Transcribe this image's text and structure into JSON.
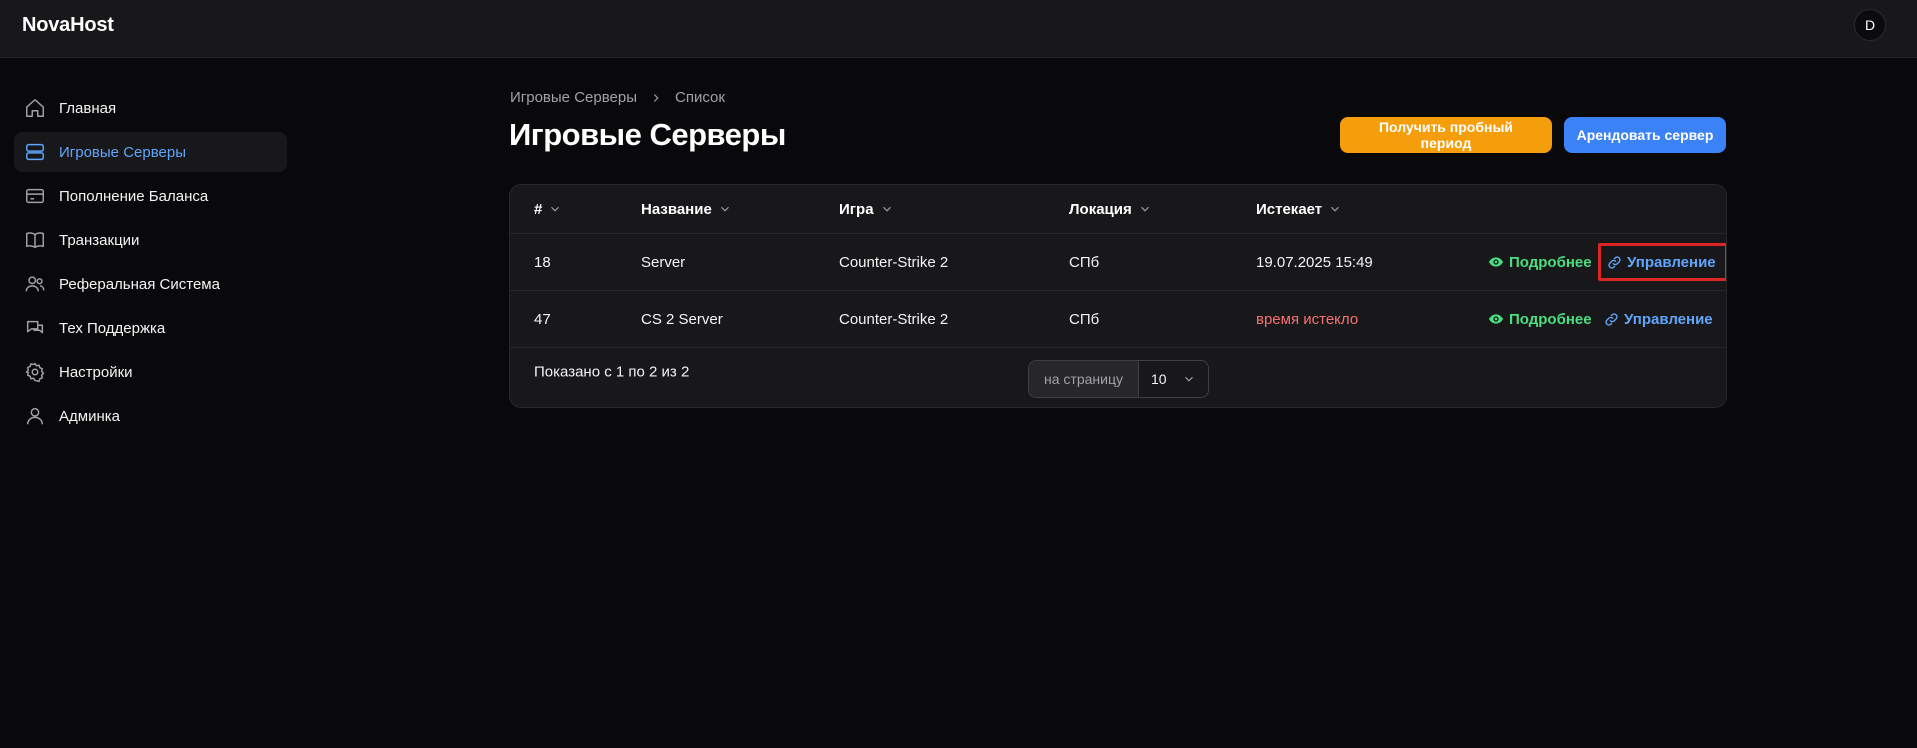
{
  "app": {
    "brand": "NovaHost",
    "avatar_letter": "D"
  },
  "sidebar": {
    "items": [
      {
        "label": "Главная",
        "icon": "home-icon",
        "active": false
      },
      {
        "label": "Игровые Серверы",
        "icon": "server-icon",
        "active": true
      },
      {
        "label": "Пополнение Баланса",
        "icon": "credit-card-icon",
        "active": false
      },
      {
        "label": "Транзакции",
        "icon": "book-icon",
        "active": false
      },
      {
        "label": "Реферальная Система",
        "icon": "users-icon",
        "active": false
      },
      {
        "label": "Тех Поддержка",
        "icon": "chat-icon",
        "active": false
      },
      {
        "label": "Настройки",
        "icon": "gear-icon",
        "active": false
      },
      {
        "label": "Админка",
        "icon": "user-icon",
        "active": false
      }
    ]
  },
  "breadcrumb": {
    "parent": "Игровые Серверы",
    "current": "Список"
  },
  "page": {
    "title": "Игровые Серверы"
  },
  "actions": {
    "trial_label": "Получить пробный период",
    "rent_label": "Арендовать сервер"
  },
  "table": {
    "columns": [
      "#",
      "Название",
      "Игра",
      "Локация",
      "Истекает"
    ],
    "rows": [
      {
        "id": "18",
        "name": "Server",
        "game": "Counter-Strike 2",
        "location": "СПб",
        "expires": "19.07.2025 15:49",
        "expired": false
      },
      {
        "id": "47",
        "name": "CS 2 Server",
        "game": "Counter-Strike 2",
        "location": "СПб",
        "expires": "время истекло",
        "expired": true
      }
    ],
    "row_actions": {
      "details": "Подробнее",
      "manage": "Управление"
    },
    "footer": {
      "summary": "Показано с 1 по 2 из 2",
      "per_page_label": "на страницу",
      "per_page_value": "10"
    }
  },
  "colors": {
    "accent_blue": "#3b82f6",
    "accent_orange": "#f59e0b",
    "success_green": "#4ade80",
    "danger_red": "#f87171",
    "highlight_box": "#dc2626"
  }
}
